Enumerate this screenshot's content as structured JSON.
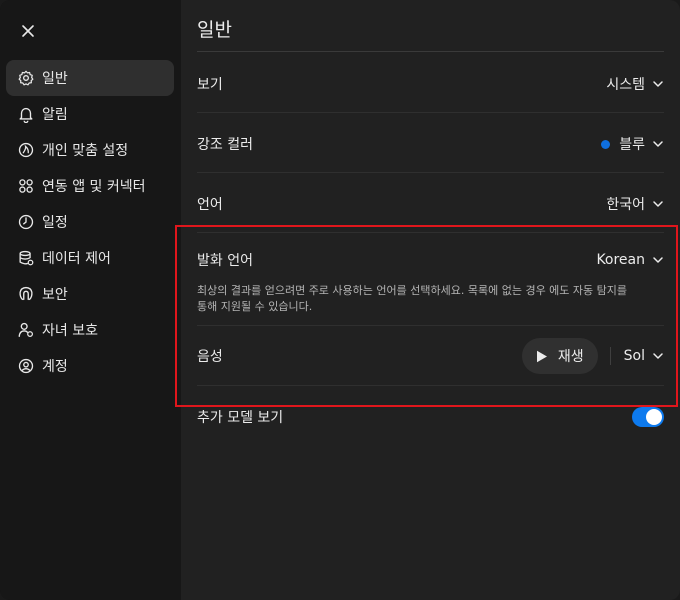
{
  "sidebar": {
    "items": [
      {
        "label": "일반",
        "icon": "gear-icon"
      },
      {
        "label": "알림",
        "icon": "bell-icon"
      },
      {
        "label": "개인 맞춤 설정",
        "icon": "personalization-icon"
      },
      {
        "label": "연동 앱 및 커넥터",
        "icon": "connectors-icon"
      },
      {
        "label": "일정",
        "icon": "clock-icon"
      },
      {
        "label": "데이터 제어",
        "icon": "database-icon"
      },
      {
        "label": "보안",
        "icon": "security-icon"
      },
      {
        "label": "자녀 보호",
        "icon": "parental-icon"
      },
      {
        "label": "계정",
        "icon": "account-icon"
      }
    ]
  },
  "main": {
    "title": "일반",
    "view": {
      "label": "보기",
      "value": "시스템"
    },
    "accent": {
      "label": "강조 컬러",
      "value": "블루",
      "color": "#0f6fde"
    },
    "language": {
      "label": "언어",
      "value": "한국어"
    },
    "spoken_language": {
      "label": "발화 언어",
      "value": "Korean",
      "description": "최상의 결과를 얻으려면 주로 사용하는 언어를 선택하세요. 목록에 없는 경우 에도 자동 탐지를 통해 지원될 수 있습니다."
    },
    "voice": {
      "label": "음성",
      "play_label": "재생",
      "value": "Sol"
    },
    "additional_models": {
      "label": "추가 모델 보기",
      "enabled": true
    }
  },
  "colors": {
    "highlight": "#e0161c",
    "toggle_on": "#0d7aee"
  }
}
